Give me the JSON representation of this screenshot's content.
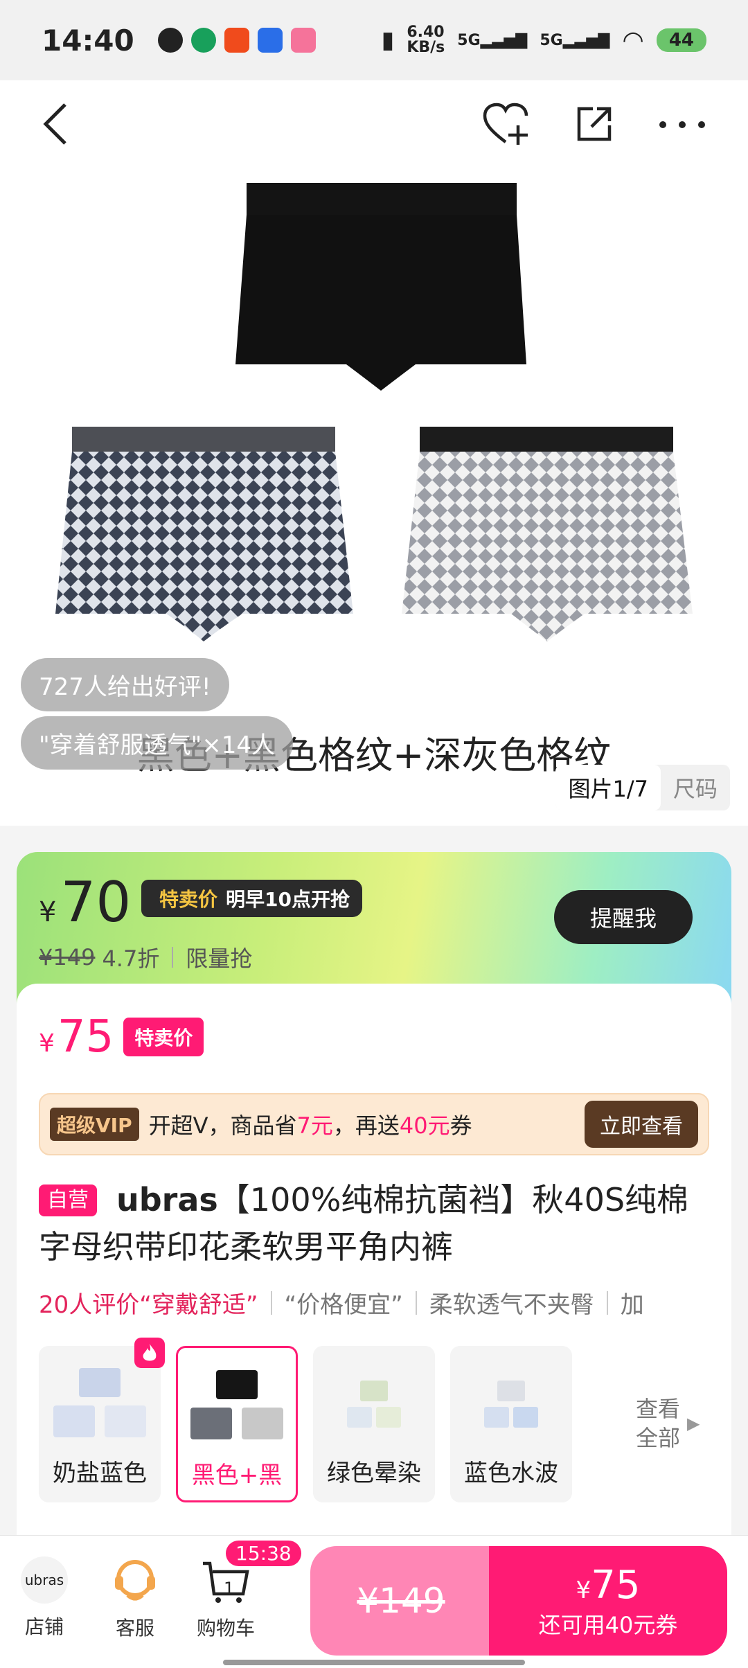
{
  "status": {
    "time": "14:40",
    "net_speed": "6.40\nKB/s",
    "sig1": "5G",
    "sig2": "5G",
    "battery": "44"
  },
  "gallery": {
    "caption": "黑色+黑色格纹+深灰色格纹",
    "review_bubble_1": "727人给出好评!",
    "review_bubble_2": "\"穿着舒服透气\"×14人",
    "tab_image": "图片1/7",
    "tab_size": "尺码"
  },
  "flash": {
    "price": "70",
    "yen": "¥",
    "tag_label": "特卖价",
    "tag_time": "明早10点开抢",
    "remind": "提醒我",
    "orig_price": "¥149",
    "discount": "4.7折",
    "limited": "限量抢"
  },
  "sale": {
    "yen": "¥",
    "price": "75",
    "tag": "特卖价"
  },
  "vip": {
    "badge": "超级VIP",
    "text_a": "开超V，商品省",
    "amount1": "7元",
    "text_b": "，再送",
    "amount2": "40元",
    "text_c": "券",
    "button": "立即查看"
  },
  "product": {
    "self_tag": "自营",
    "brand": "ubras",
    "title": "【100%纯棉抗菌裆】秋40S纯棉字母织带印花柔软男平角内裤"
  },
  "tags": {
    "first": "20人评价“穿戴舒适”",
    "second": "“价格便宜”",
    "third": "柔软透气不夹臀",
    "fourth": "加"
  },
  "skus": [
    {
      "label": "奶盐蓝色"
    },
    {
      "label": "黑色+黑"
    },
    {
      "label": "绿色晕染"
    },
    {
      "label": "蓝色水波"
    }
  ],
  "see_all": {
    "line1": "查看",
    "line2": "全部"
  },
  "bottom": {
    "shop_logo": "ubras",
    "shop": "店铺",
    "service": "客服",
    "cart": "购物车",
    "cart_count": "1",
    "timer": "15:38",
    "buy_orig": "¥149",
    "buy_yen": "¥",
    "buy_price": "75",
    "buy_sub": "还可用40元券"
  },
  "colors": {
    "accent": "#ff1b74",
    "vip_brown": "#5a3a23"
  }
}
